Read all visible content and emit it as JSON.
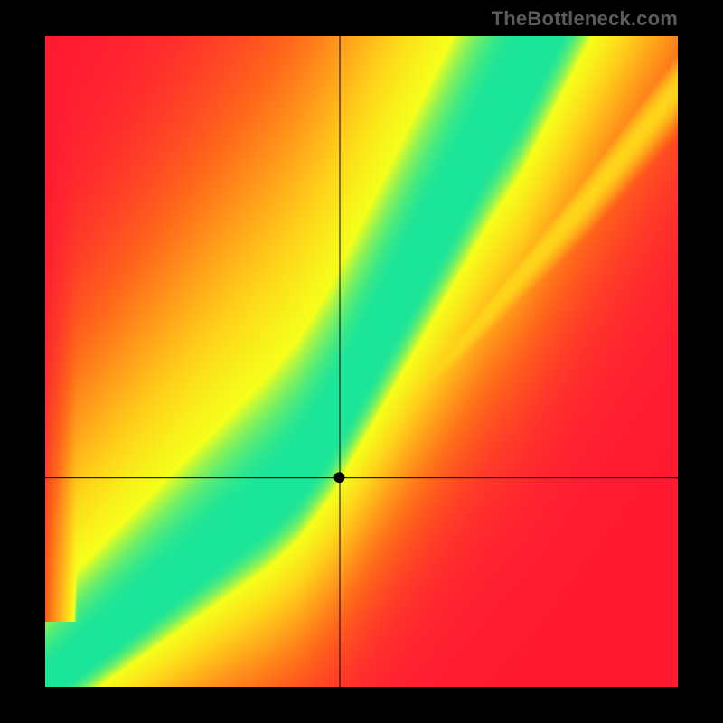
{
  "watermark": "TheBottleneck.com",
  "chart_data": {
    "type": "heatmap",
    "title": "",
    "xlabel": "",
    "ylabel": "",
    "xlim": [
      0,
      1
    ],
    "ylim": [
      0,
      1
    ],
    "grid": false,
    "crosshair": {
      "x": 0.465,
      "y": 0.322
    },
    "marker": {
      "x": 0.465,
      "y": 0.322,
      "radius_px": 6
    },
    "optimal_curve_points": [
      [
        0.0,
        0.0
      ],
      [
        0.05,
        0.04
      ],
      [
        0.1,
        0.08
      ],
      [
        0.15,
        0.12
      ],
      [
        0.2,
        0.16
      ],
      [
        0.25,
        0.2
      ],
      [
        0.3,
        0.24
      ],
      [
        0.35,
        0.28
      ],
      [
        0.4,
        0.33
      ],
      [
        0.45,
        0.4
      ],
      [
        0.5,
        0.49
      ],
      [
        0.55,
        0.58
      ],
      [
        0.6,
        0.67
      ],
      [
        0.65,
        0.76
      ],
      [
        0.7,
        0.85
      ],
      [
        0.75,
        0.93
      ],
      [
        0.78,
        0.99
      ]
    ],
    "secondary_ridge_points": [
      [
        0.45,
        0.33
      ],
      [
        0.55,
        0.42
      ],
      [
        0.65,
        0.52
      ],
      [
        0.75,
        0.63
      ],
      [
        0.85,
        0.74
      ],
      [
        0.95,
        0.86
      ],
      [
        1.0,
        0.92
      ]
    ],
    "color_stops": {
      "worst": "#ff1a33",
      "bad": "#ff6a1a",
      "mid": "#ffd21a",
      "near": "#f6ff1a",
      "best": "#1ae59a"
    },
    "field_description": "Value at (x,y) encodes match quality: 1.0 on the optimal curve (green), decaying through yellow/orange to red with distance from curve; asymmetric falloff is steeper toward lower-left and upper-right corners."
  }
}
